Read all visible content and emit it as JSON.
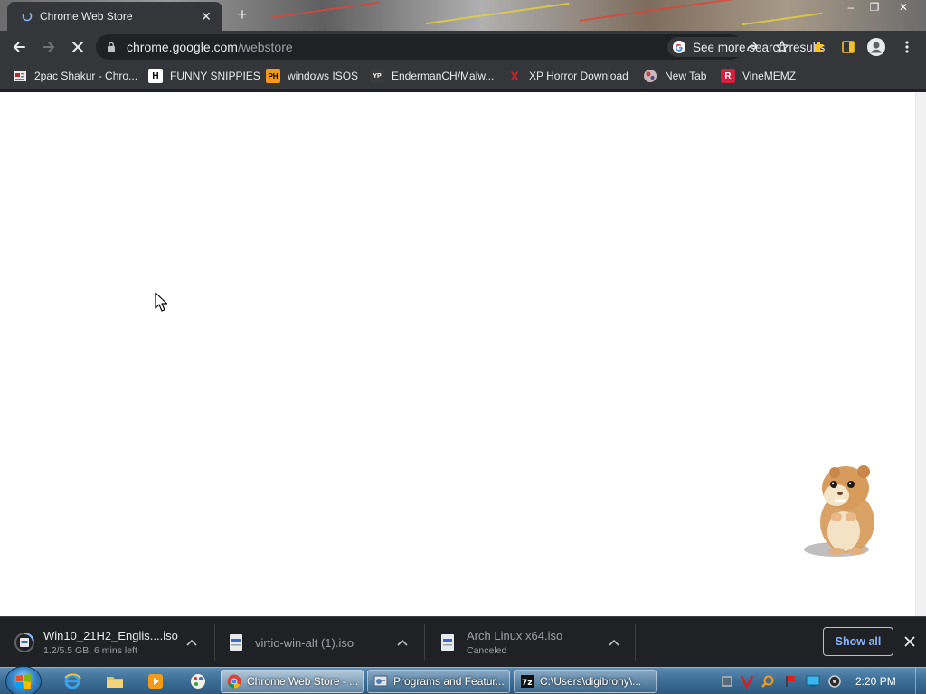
{
  "tab": {
    "title": "Chrome Web Store",
    "close_glyph": "✕"
  },
  "new_tab_glyph": "+",
  "window_controls": {
    "minimize": "–",
    "restore": "❐",
    "close": "✕"
  },
  "address_bar": {
    "domain": "chrome.google.com",
    "path": "/webstore",
    "search_chip_label": "See more search results"
  },
  "bookmarks": [
    {
      "label": "2pac Shakur - Chro...",
      "icon": "news-icon",
      "icon_text": "",
      "icon_color": "#e8eaed"
    },
    {
      "label": "FUNNY SNIPPIES",
      "icon": "h-logo-icon",
      "icon_text": "H",
      "icon_color": "#ffffff"
    },
    {
      "label": "windows ISOS",
      "icon": "ph-logo-icon",
      "icon_text": "PH",
      "icon_color": "#f7971d"
    },
    {
      "label": "EndermanCH/Malw...",
      "icon": "yp-logo-icon",
      "icon_text": "YP",
      "icon_color": "#3a3a3a"
    },
    {
      "label": "XP Horror Download",
      "icon": "x-logo-icon",
      "icon_text": "X",
      "icon_color": "#e02020"
    },
    {
      "label": "New Tab",
      "icon": "ball-icon",
      "icon_text": "",
      "icon_color": "#d08080"
    },
    {
      "label": "VineMEMZ",
      "icon": "r-logo-icon",
      "icon_text": "R",
      "icon_color": "#d21f3c"
    }
  ],
  "downloads": [
    {
      "name": "Win10_21H2_Englis....iso",
      "status": "1.2/5.5 GB, 6 mins left",
      "progress": 0.22,
      "icon": "iso-file-icon"
    },
    {
      "name": "virtio-win-alt (1).iso",
      "status": "",
      "icon": "iso-file-icon"
    },
    {
      "name": "Arch Linux x64.iso",
      "status": "Canceled",
      "icon": "iso-file-icon"
    }
  ],
  "show_all_label": "Show all",
  "taskbar": {
    "tasks": [
      {
        "label": "Chrome Web Store - ...",
        "icon": "chrome-icon",
        "active": true
      },
      {
        "label": "Programs and Featur...",
        "icon": "control-panel-icon",
        "active": false
      },
      {
        "label": "C:\\Users\\digibrony\\...",
        "icon": "7zip-icon",
        "active": false
      }
    ],
    "clock": "2:20 PM"
  },
  "colors": {
    "chrome_dark": "#35363a",
    "omnibox": "#202124",
    "link_blue": "#8ab4f8",
    "taskbar_blue": "#3e6f97"
  }
}
